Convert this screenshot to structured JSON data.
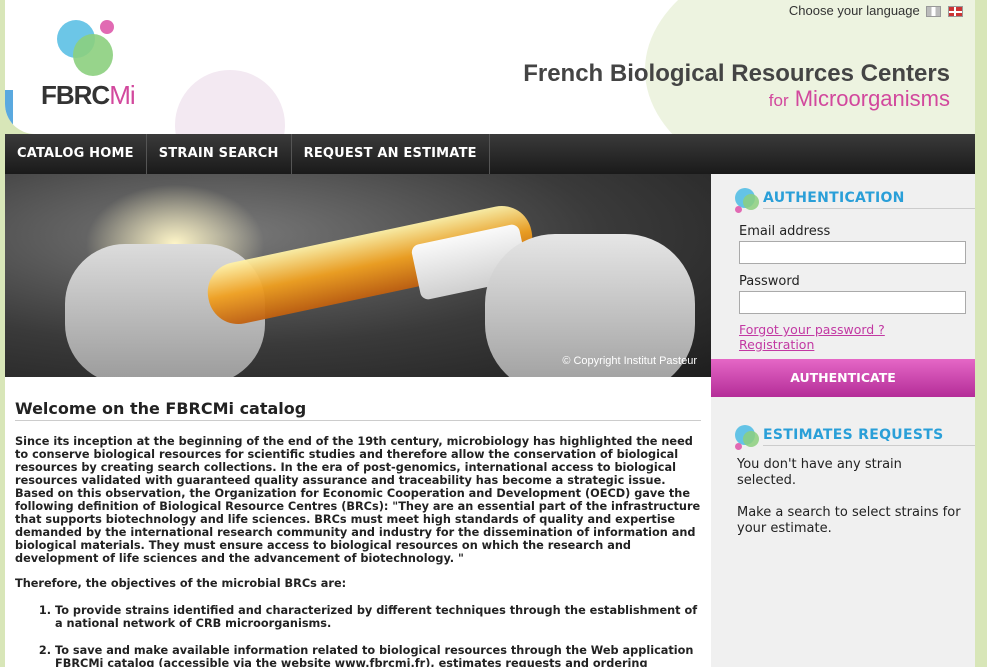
{
  "header": {
    "logo_text": "FBRC",
    "logo_text_mi": "Mi",
    "language_label": "Choose your language",
    "title_line1": "French Biological Resources Centers",
    "title_for": "for",
    "title_line2": "Microorganisms"
  },
  "nav": {
    "items": [
      {
        "label": "CATALOG HOME"
      },
      {
        "label": "STRAIN SEARCH"
      },
      {
        "label": "REQUEST AN ESTIMATE"
      }
    ]
  },
  "banner": {
    "copyright": "© Copyright  Institut Pasteur"
  },
  "main": {
    "title": "Welcome on the FBRCMi catalog",
    "intro": "Since its inception at the beginning of the end of the 19th century, microbiology has highlighted the need to conserve biological resources for scientific studies and therefore allow the conservation of biological resources by creating search collections. In the era of post-genomics, international access to biological resources validated with guaranteed quality assurance and traceability has become a strategic issue. Based on this observation, the Organization for Economic Cooperation and Development (OECD) gave the following definition of Biological Resource Centres (BRCs): \"They are an essential part of the infrastructure that supports biotechnology and life sciences. BRCs must meet high standards of quality and expertise demanded by the international research community and industry for the dissemination of information and biological materials. They must ensure access to biological resources on which the research and development of life sciences and the advancement of biotechnology. \"",
    "objectives_intro": "Therefore, the objectives of the microbial BRCs are:",
    "objectives": [
      "To provide strains identified and characterized by different techniques through the establishment of a national network of CRB microorganisms.",
      "To save and make available information related to biological resources through the Web application FBRCMi catalog (accessible via the website www.fbrcmi.fr), estimates requests and ordering"
    ]
  },
  "auth": {
    "title": "AUTHENTICATION",
    "email_label": "Email address",
    "email_value": "",
    "password_label": "Password",
    "password_value": "",
    "forgot_link": "Forgot your password ?",
    "registration_link": "Registration",
    "button_label": "AUTHENTICATE"
  },
  "estimates": {
    "title": "ESTIMATES REQUESTS",
    "text1": "You don't have any strain selected.",
    "text2": "Make a search to select strains for your estimate."
  },
  "colors": {
    "accent_blue": "#2a9fd8",
    "accent_pink": "#d2489d",
    "nav_bg": "#222222"
  }
}
